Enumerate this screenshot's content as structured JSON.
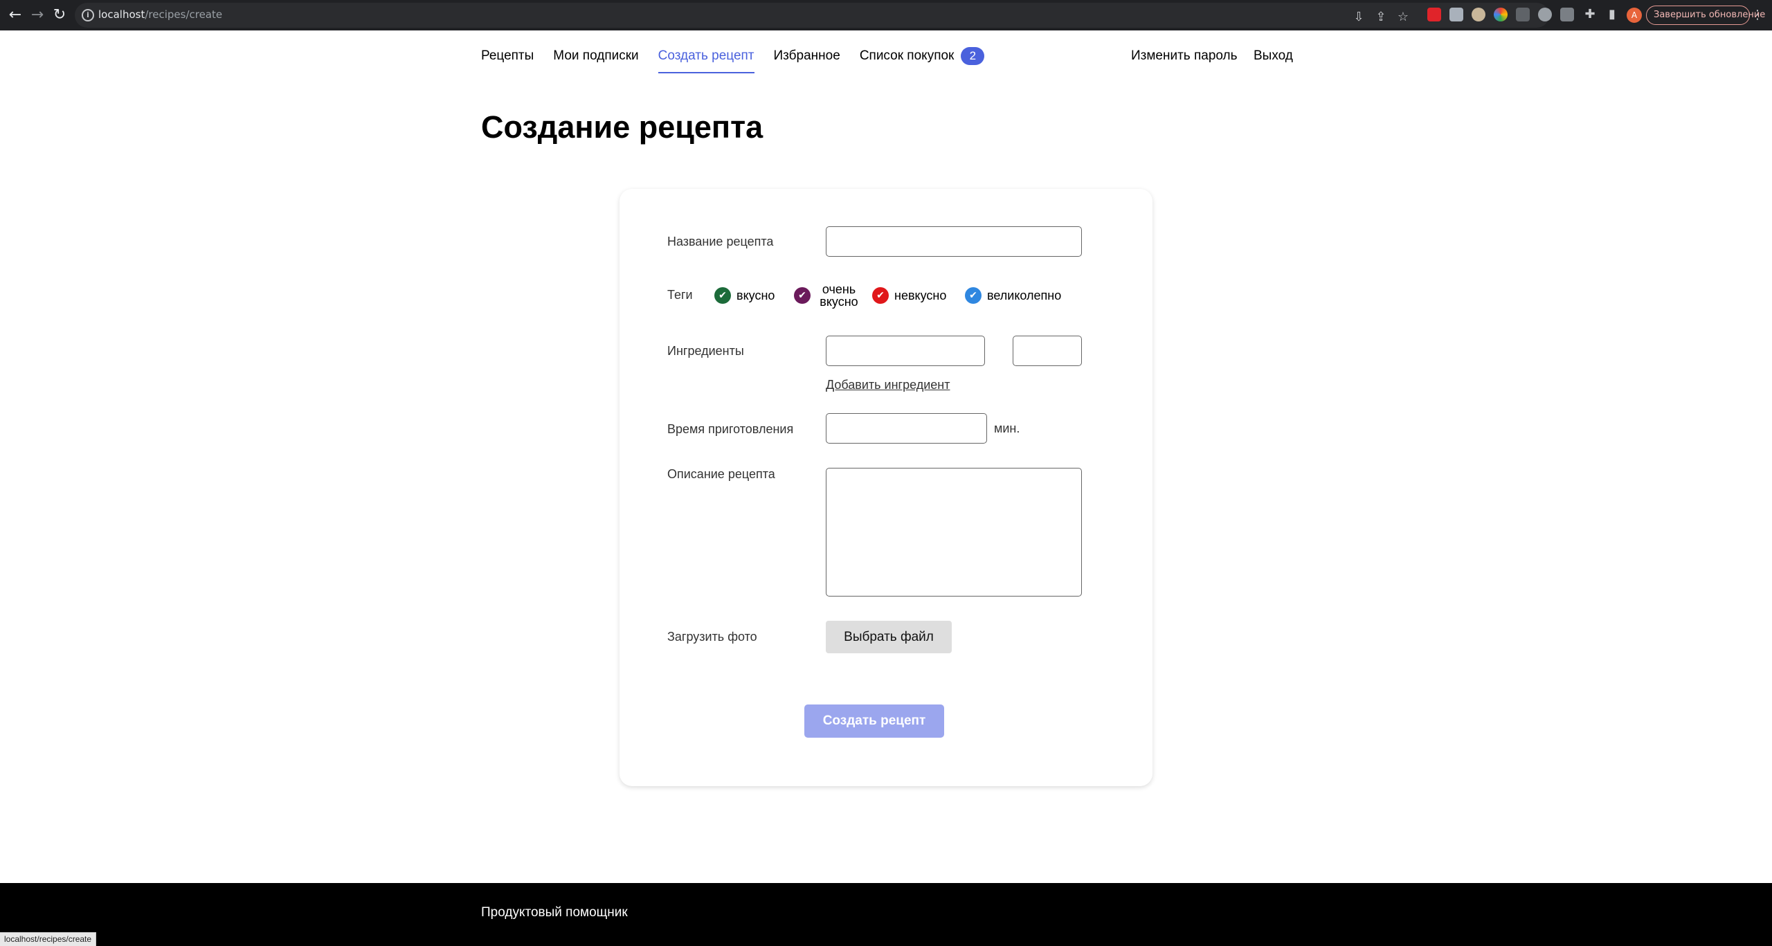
{
  "browser": {
    "url_host": "localhost",
    "url_path": "/recipes/create",
    "avatar_letter": "A",
    "update_button": "Завершить обновление"
  },
  "nav": {
    "items": [
      {
        "label": "Рецепты"
      },
      {
        "label": "Мои подписки"
      },
      {
        "label": "Создать рецепт",
        "active": true
      },
      {
        "label": "Избранное"
      },
      {
        "label": "Список покупок",
        "badge": "2"
      }
    ],
    "change_password": "Изменить пароль",
    "logout": "Выход",
    "accent_color": "#4a61dd"
  },
  "page": {
    "title": "Создание рецепта"
  },
  "form": {
    "name_label": "Название рецепта",
    "name_value": "",
    "tags_label": "Теги",
    "tags": [
      {
        "label": "вкусно",
        "color": "#1c6b3a",
        "checked": true
      },
      {
        "label": "очень вкусно",
        "color": "#6b1a5b",
        "checked": true
      },
      {
        "label": "невкусно",
        "color": "#e0171a",
        "checked": true
      },
      {
        "label": "великолепно",
        "color": "#2f87e0",
        "checked": true
      }
    ],
    "ingredients_label": "Ингредиенты",
    "ingredient_name_value": "",
    "ingredient_amount_value": "",
    "add_ingredient": "Добавить ингредиент",
    "cook_time_label": "Время приготовления",
    "cook_time_value": "",
    "cook_time_unit": "мин.",
    "description_label": "Описание рецепта",
    "description_value": "",
    "photo_label": "Загрузить фото",
    "file_button": "Выбрать файл",
    "submit_button": "Создать рецепт"
  },
  "footer": {
    "brand": "Продуктовый помощник"
  },
  "status_bar": {
    "url": "localhost/recipes/create"
  }
}
